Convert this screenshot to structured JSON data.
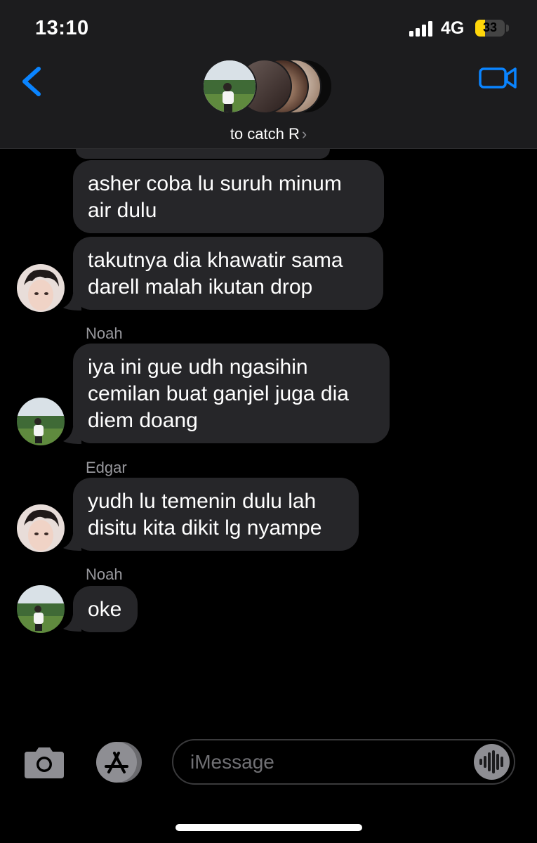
{
  "status_bar": {
    "time": "13:10",
    "network": "4G",
    "battery_percent": "33",
    "battery_level": 0.33,
    "battery_color": "#ffd60a"
  },
  "header": {
    "group_name": "to catch R",
    "chevron": "›",
    "back_icon": "chevron-left-icon",
    "video_icon": "video-camera-icon",
    "accent_color": "#0a84ff",
    "avatar_count": 5
  },
  "messages": [
    {
      "text": "",
      "sender": "",
      "partial": true
    },
    {
      "text": "asher coba lu suruh minum\nair dulu",
      "sender": ""
    },
    {
      "text": "takutnya dia khawatir sama\ndarell malah ikutan drop",
      "sender": ""
    },
    {
      "text": "iya ini gue udh ngasihin\ncemilan buat ganjel juga dia\ndiem doang",
      "sender": "Noah"
    },
    {
      "text": "yudh lu temenin dulu lah\ndisitu kita dikit lg nyampe",
      "sender": "Edgar"
    },
    {
      "text": "oke",
      "sender": "Noah"
    }
  ],
  "bubble_color": "#262629",
  "composer": {
    "placeholder": "iMessage",
    "camera_icon": "camera-icon",
    "apps_icon": "app-store-icon",
    "audio_icon": "waveform-icon"
  }
}
